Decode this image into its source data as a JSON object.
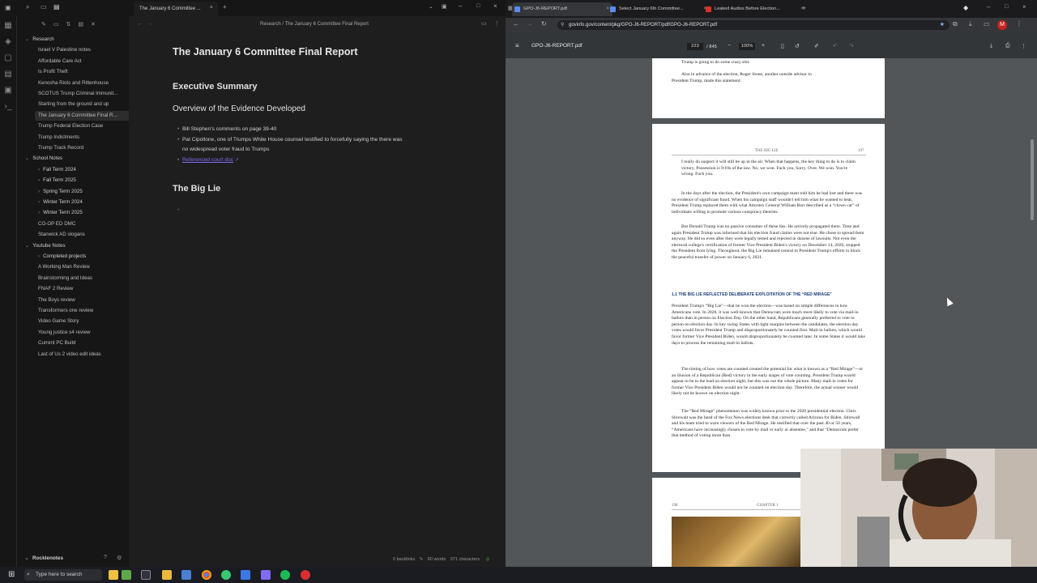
{
  "obsidian": {
    "tab_title": "The January 6 Committee ...",
    "breadcrumb": "Research / The January 6 Committee Final Report",
    "sidebar": {
      "items": [
        {
          "label": "Research",
          "type": "folder"
        },
        {
          "label": "Israel V Palestine notes",
          "type": "file"
        },
        {
          "label": "Affordable Care Act",
          "type": "file"
        },
        {
          "label": "Is Profit Theft",
          "type": "file"
        },
        {
          "label": "Kenosha Riots and Rittenhouse",
          "type": "file"
        },
        {
          "label": "SCOTUS Trump Criminal Immunit...",
          "type": "file"
        },
        {
          "label": "Starting from the ground and up",
          "type": "file"
        },
        {
          "label": "The January 6 Committee Final R...",
          "type": "file",
          "selected": true
        },
        {
          "label": "Trump Federal Election Case",
          "type": "file"
        },
        {
          "label": "Trump Indictments",
          "type": "file"
        },
        {
          "label": "Trump Track Record",
          "type": "file"
        },
        {
          "label": "School Notes",
          "type": "folder"
        },
        {
          "label": "Fall Term 2024",
          "type": "folder"
        },
        {
          "label": "Fall Term 2025",
          "type": "folder"
        },
        {
          "label": "Spring Term 2025",
          "type": "folder"
        },
        {
          "label": "Winter Term 2024",
          "type": "folder"
        },
        {
          "label": "Winter Term 2025",
          "type": "folder"
        },
        {
          "label": "CO-OP ED DMC",
          "type": "file"
        },
        {
          "label": "Stanwick AD slogans",
          "type": "file"
        },
        {
          "label": "Youtube Notes",
          "type": "folder"
        },
        {
          "label": "Completed projects",
          "type": "folder"
        },
        {
          "label": "A Working Man Review",
          "type": "file"
        },
        {
          "label": "Brainstorming and Ideas",
          "type": "file"
        },
        {
          "label": "FNAF 2 Review",
          "type": "file"
        },
        {
          "label": "The Boys review",
          "type": "file"
        },
        {
          "label": "Transformers one review",
          "type": "file"
        },
        {
          "label": "Video Game Story",
          "type": "file"
        },
        {
          "label": "Young justice s4 review",
          "type": "file"
        },
        {
          "label": "Current PC Build",
          "type": "file"
        },
        {
          "label": "Last of Us 2 video edit ideas",
          "type": "file"
        }
      ],
      "vault_name": "Rocklenotes"
    },
    "note": {
      "title": "The January 6 Committee Final Report",
      "h2_exec": "Executive Summary",
      "h3_overview": "Overview of the Evidence Developed",
      "bullets": [
        "Bill Stephen's comments on page 39-40",
        "Pat Cipollone, one of Trumps White House counsel testified to forcefully saying the there was",
        "no widespread voter fraud to Trumps"
      ],
      "link_text": "Referenced court doc",
      "h2_biglie": "The Big Lie"
    },
    "status": {
      "backlinks": "0 backlinks",
      "words": "60 words",
      "chars": "371 characters"
    }
  },
  "browser": {
    "tabs": [
      {
        "label": "GPO-J6-REPORT.pdf",
        "active": true,
        "favicon_color": "#5b8def"
      },
      {
        "label": "Select January 6th Committee...",
        "active": false,
        "favicon_color": "#5b8def"
      },
      {
        "label": "Leaked Audios Before Election...",
        "active": false,
        "favicon_color": "#d93025"
      }
    ],
    "url": "govinfo.gov/content/pkg/GPO-J6-REPORT/pdf/GPO-J6-REPORT.pdf",
    "pdf": {
      "file_title": "GPO-J6-REPORT.pdf",
      "page_current": "223",
      "page_total": "/ 845",
      "zoom": "100%",
      "page_a_lines": [
        "Trump is going to do some crazy shit.",
        "Also in advance of the election, Roger Stone, another outside advisor to",
        "President Trump, made this statement:"
      ],
      "page_b_header_left": "THE BIG LIE",
      "page_b_header_right": "197",
      "page_b_quote": "I really do suspect it will still be up in the air. When that happens, the key thing to do is to claim victory. Possession is 9/10s of the law. No, we won. Fuck you, Sorry. Over. We won. You're wrong. Fuck you.",
      "page_b_para1": "In the days after the election, the President's own campaign team told him he had lost and there was no evidence of significant fraud. When his campaign staff wouldn't tell him what he wanted to hear, President Trump replaced them with what Attorney General William Barr described as a “clown car” of individuals willing to promote various conspiracy theories.",
      "page_b_para2": "But Donald Trump was no passive consumer of these lies. He actively propagated them. Time and again President Trump was informed that his election fraud claims were not true. He chose to spread them anyway. He did so even after they were legally tested and rejected in dozens of lawsuits. Not even the electoral college's certification of former Vice President Biden's victory on December 14, 2020, stopped the President from lying. Throughout, the Big Lie remained central to President Trump's efforts to block the peaceful transfer of power on January 6, 2021.",
      "page_b_section": "1.1  THE BIG LIE REFLECTED DELIBERATE EXPLOITATION OF THE “RED MIRAGE”",
      "page_b_para3": "President Trump's “Big Lie”—that he won the election—was based on simple differences in how Americans vote. In 2020, it was well-known that Democrats were much more likely to vote via mail-in ballots than in person on Election Day. On the other hand, Republicans generally preferred to vote in person on election day. In key swing States with tight margins between the candidates, the election day votes would favor President Trump and disproportionately be counted first. Mail-in ballots, which would favor former Vice President Biden, would disproportionately be counted later. In some States it would take days to process the remaining mail-in ballots.",
      "page_b_para4": "The timing of how votes are counted created the potential for what is known as a “Red Mirage”—or an illusion of a Republican (Red) victory in the early stages of vote counting. President Trump would appear to be in the lead on election night, but this was not the whole picture. Many mail-in votes for former Vice President Biden would not be counted on election day. Therefore, the actual winner would likely not be known on election night.",
      "page_b_para5": "The “Red Mirage” phenomenon was widely known prior to the 2020 presidential election. Chris Stirewalt was the head of the Fox News elections desk that correctly called Arizona for Biden. Stirewall and his team tried to warn viewers of the Red Mirage. He testified that over the past 40 or 50 years, “Americans have increasingly chosen to vote by mail or early or absentee,” and that “Democrats prefer that method of voting more than",
      "page_c_header_left": "198",
      "page_c_header_right": "CHAPTER 1"
    }
  },
  "taskbar": {
    "search_placeholder": "Type here to search"
  },
  "colors": {
    "accent": "#7f6df2",
    "pdf_bg": "#525659",
    "browser_dark": "#202124"
  }
}
